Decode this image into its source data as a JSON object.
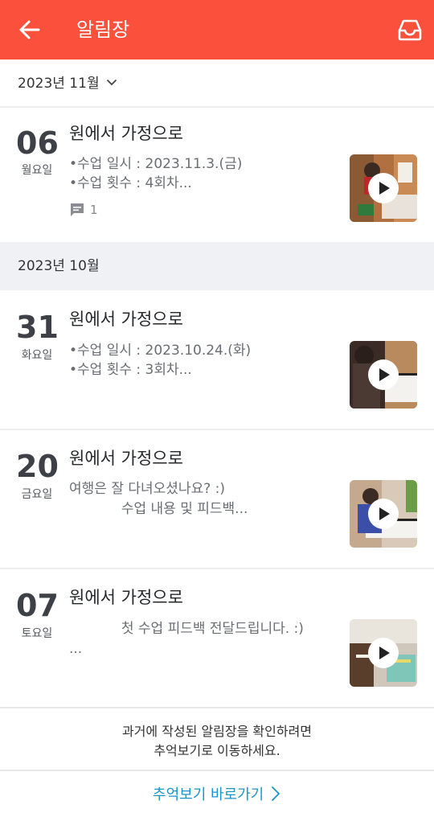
{
  "header": {
    "title": "알림장",
    "back_icon": "back-arrow-icon",
    "inbox_icon": "inbox-tray-icon",
    "color": "#fa503c"
  },
  "months": [
    {
      "label": "2023년 11월"
    },
    {
      "label": "2023년 10월"
    }
  ],
  "posts": [
    {
      "day": "06",
      "weekday": "월요일",
      "title": "원에서 가정으로",
      "line1": "•수업 일시 : 2023.11.3.(금)",
      "line2": "•수업 횟수 : 4회차...",
      "comments": "1",
      "thumb_icon": "play-icon"
    },
    {
      "day": "31",
      "weekday": "화요일",
      "title": "원에서 가정으로",
      "line1": "•수업 일시 : 2023.10.24.(화)",
      "line2": "•수업 횟수 : 3회차...",
      "thumb_icon": "play-icon"
    },
    {
      "day": "20",
      "weekday": "금요일",
      "title": "원에서 가정으로",
      "line1": "여행은 잘 다녀오셨나요? :)",
      "line2": "            수업 내용 및 피드백...",
      "thumb_icon": "play-icon"
    },
    {
      "day": "07",
      "weekday": "토요일",
      "title": "원에서 가정으로",
      "line1": "            첫 수업 피드백 전달드립니다. :)",
      "line2": "...",
      "thumb_icon": "play-icon"
    }
  ],
  "footer": {
    "info_line1": "과거에 작성된 알림장을 확인하려면",
    "info_line2": "추억보기로 이동하세요.",
    "link_label": "추억보기 바로가기",
    "link_color": "#1c94c9"
  }
}
